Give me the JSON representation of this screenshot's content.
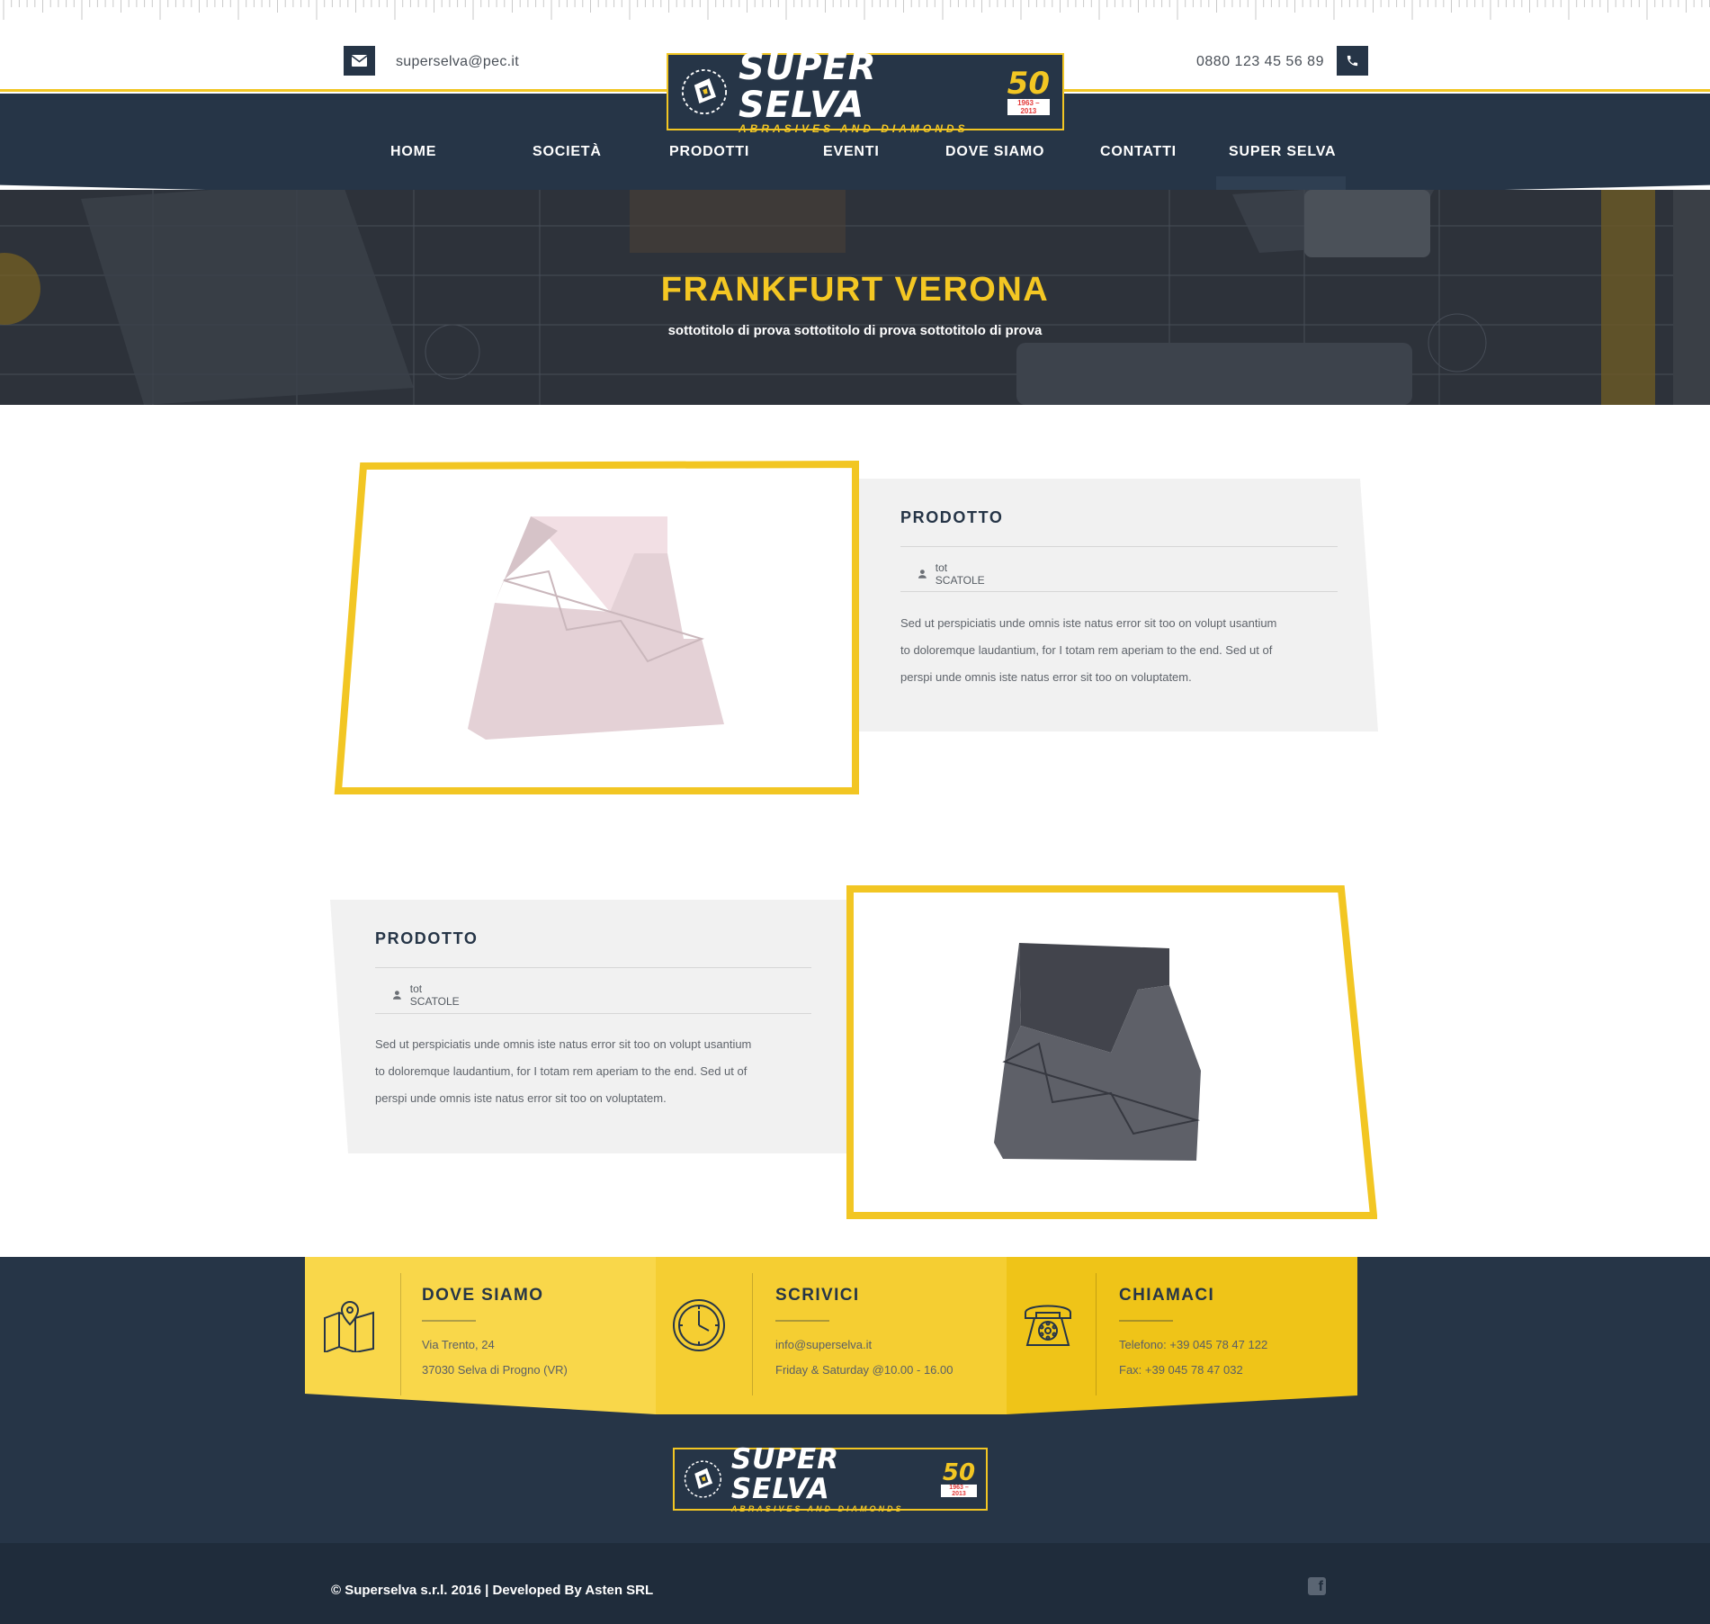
{
  "topbar": {
    "email": "superselva@pec.it",
    "phone": "0880 123 45 56 89"
  },
  "logo": {
    "brand": "SUPER SELVA",
    "tagline": "ABRASIVES AND DIAMONDS",
    "anniversary": "50",
    "years": "1963 – 2013"
  },
  "nav": {
    "items": [
      "HOME",
      "SOCIETÀ",
      "PRODOTTI",
      "EVENTI",
      "DOVE SIAMO",
      "CONTATTI",
      "SUPER SELVA"
    ],
    "active": "SUPER SELVA"
  },
  "hero": {
    "title": "FRANKFURT VERONA",
    "subtitle": "sottotitolo di prova sottotitolo di prova sottotitolo di prova"
  },
  "products": [
    {
      "title": "PRODOTTO",
      "meta": "tot SCATOLE",
      "description": [
        "Sed ut perspiciatis unde omnis iste natus error sit too on volupt usantium",
        "to doloremque laudantium, for I totam rem aperiam to the end. Sed ut of",
        "perspi unde omnis iste natus error sit too on voluptatem."
      ],
      "image_color": "#f2dfe4"
    },
    {
      "title": "PRODOTTO",
      "meta": "tot SCATOLE",
      "description": [
        "Sed ut perspiciatis unde omnis iste natus error sit too on volupt usantium",
        "to doloremque laudantium, for I totam rem aperiam to the end. Sed ut of",
        "perspi unde omnis iste natus error sit too on voluptatem."
      ],
      "image_color": "#5e6068"
    }
  ],
  "footer": {
    "where": {
      "title": "DOVE SIAMO",
      "line1": "Via Trento, 24",
      "line2": "37030 Selva di Progno (VR)",
      "icon": "map-icon"
    },
    "write": {
      "title": "SCRIVICI",
      "line1": "info@superselva.it",
      "line2": "Friday & Saturday @10.00 - 16.00",
      "icon": "clock-icon"
    },
    "call": {
      "title": "CHIAMACI",
      "line1": "Telefono: +39 045 78 47 122",
      "line2": "Fax: +39 045 78 47 032",
      "icon": "telephone-icon"
    },
    "copyright": "© Superselva s.r.l. 2016 | Developed By Asten SRL"
  },
  "colors": {
    "navy": "#263547",
    "accent": "#f2c623",
    "panel": "#f1f1f1"
  }
}
